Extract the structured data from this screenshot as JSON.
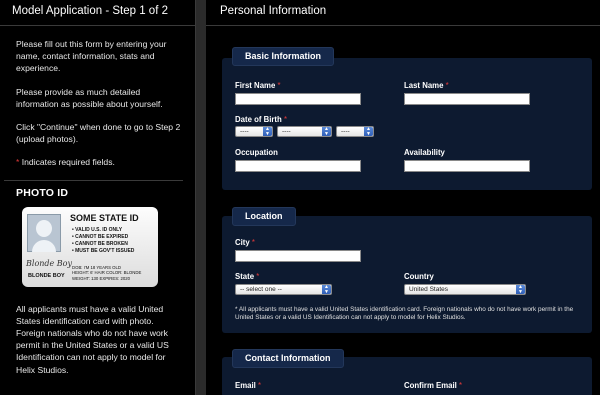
{
  "left": {
    "header": "Model Application - Step 1 of 2",
    "intro": "Please fill out this form by entering your name, contact information, stats and experience.",
    "detail": "Please provide as much detailed information as possible about yourself.",
    "continue": "Click \"Continue\" when done to go to Step 2 (upload photos).",
    "required_star": "*",
    "required_text": " Indicates required fields.",
    "photo_title": "PHOTO ID",
    "id_card": {
      "title": "SOME STATE ID",
      "items": [
        "• VALID U.S. ID ONLY",
        "• CANNOT BE EXPIRED",
        "• CANNOT BE BROKEN",
        "• MUST BE GOV'T ISSUED"
      ],
      "dob_line1": "DOB: I'M 18 YEARS OLD",
      "dob_line2": "HEIGHT: 6'  HAIR COLOR: BLONDE",
      "dob_line3": "WEIGHT: 130   EXPIRES: 2020",
      "signature": "Blonde Boy",
      "name": "BLONDE BOY"
    },
    "id_note": "All applicants must have a valid United States identification card with photo. Foreign nationals who do not have work permit in the United States or a valid US Identification can not apply to model for Helix Studios."
  },
  "right": {
    "header": "Personal Information",
    "basic": {
      "tab": "Basic Information",
      "first_name": "First Name",
      "last_name": "Last Name",
      "dob": "Date of Birth",
      "dob_placeholder": "----",
      "occupation": "Occupation",
      "availability": "Availability"
    },
    "location": {
      "tab": "Location",
      "city": "City",
      "state": "State",
      "state_value": "-- select one --",
      "country": "Country",
      "country_value": "United States",
      "note": "* All applicants must have a valid United States identification card. Foreign nationals who do not have work permit in the United States or a valid US Identification can not apply to model for Helix Studios."
    },
    "contact": {
      "tab": "Contact Information",
      "email": "Email",
      "confirm_email": "Confirm Email"
    },
    "required_star": "*"
  },
  "colors": {
    "required": "#e23a3a",
    "section_bg": "#0d1a30",
    "tab_bg": "#15284a",
    "select_arrow": "#2f5fb8"
  }
}
